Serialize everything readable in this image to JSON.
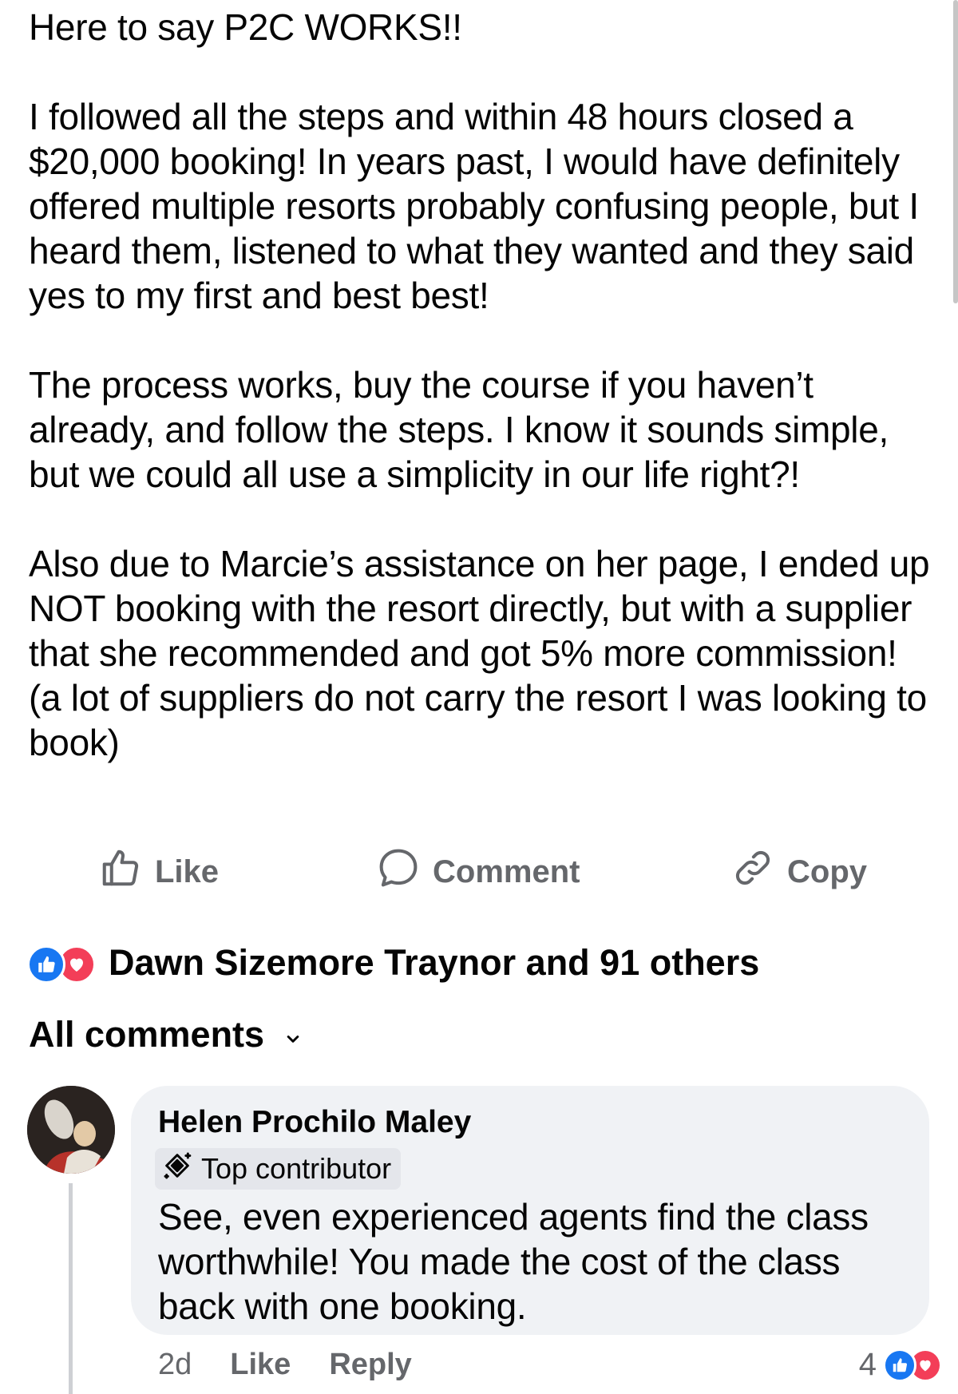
{
  "post": {
    "paragraphs": [
      "Here to say P2C WORKS!!",
      "I followed all the steps and within 48 hours closed a $20,000 booking! In years past, I would have definitely offered multiple resorts probably confusing people, but I heard them, listened to what they wanted and they said yes to my first and best best!",
      "The process works, buy the course if you haven’t already, and follow the steps. I know it sounds simple, but we could all use a simplicity in our life right?!",
      "Also due to Marcie’s assistance on her page, I ended up NOT booking with the resort directly, but with a supplier that she recommended and got 5% more commission! (a lot of suppliers do not carry the resort I was looking to book)"
    ]
  },
  "actions": {
    "like_label": "Like",
    "comment_label": "Comment",
    "copy_label": "Copy"
  },
  "reactions": {
    "summary": "Dawn Sizemore Traynor and 91 others",
    "icons": [
      "like-icon",
      "love-icon"
    ]
  },
  "comments_filter": {
    "label": "All comments"
  },
  "comment": {
    "author": "Helen Prochilo Maley",
    "badge": "Top contributor",
    "text": "See, even experienced agents find the class worthwhile!  You made the cost of the class back with one booking.",
    "time": "2d",
    "like_label": "Like",
    "reply_label": "Reply",
    "reaction_count": "4"
  },
  "colors": {
    "like_blue": "#1877f2",
    "love_red": "#f33e58",
    "secondary_text": "#65676b",
    "bubble_bg": "#f0f2f5"
  }
}
